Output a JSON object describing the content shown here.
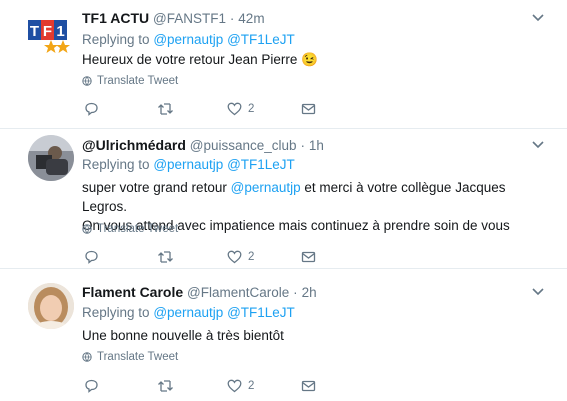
{
  "colors": {
    "link": "#1da1f2",
    "muted": "#657786",
    "text": "#14171a"
  },
  "tweets": [
    {
      "name": "TF1 ACTU",
      "handle": "@FANSTF1",
      "time": "42m",
      "replying_label": "Replying to",
      "replying_to": [
        "@pernautjp",
        "@TF1LeJT"
      ],
      "text": "Heureux de votre retour Jean Pierre",
      "emoji": "😉",
      "translate": "Translate Tweet",
      "likes": "2",
      "avatar": "tf1-logo"
    },
    {
      "name": "@Ulrichmédard",
      "handle": "@puissance_club",
      "time": "1h",
      "replying_label": "Replying to",
      "replying_to": [
        "@pernautjp",
        "@TF1LeJT"
      ],
      "text_before": "super votre grand retour",
      "text_mention": "@pernautjp",
      "text_after": " et merci à votre collègue Jacques Legros.",
      "text_line2": "On vous attend avec impatience mais continuez à prendre soin de vous",
      "translate": "Translate Tweet",
      "likes": "2",
      "avatar": "user-photo"
    },
    {
      "name": "Flament Carole",
      "handle": "@FlamentCarole",
      "time": "2h",
      "replying_label": "Replying to",
      "replying_to": [
        "@pernautjp",
        "@TF1LeJT"
      ],
      "text": "Une bonne nouvelle à très bientôt",
      "translate": "Translate Tweet",
      "likes": "2",
      "avatar": "user-photo"
    }
  ]
}
